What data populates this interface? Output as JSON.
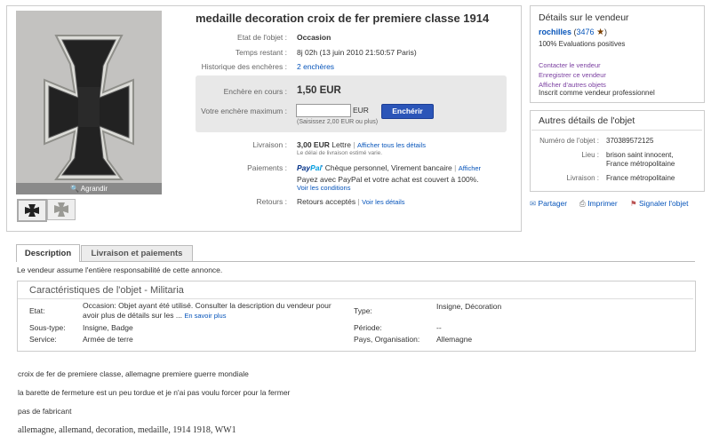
{
  "title": "medaille decoration croix de fer premiere classe 1914",
  "photo": {
    "enlarge_label": "Agrandir"
  },
  "details": {
    "etat_label": "Etat de l'objet :",
    "etat_value": "Occasion",
    "temps_label": "Temps restant :",
    "temps_value": "8j 02h (13 juin 2010 21:50:57 Paris)",
    "historique_label": "Historique des enchères :",
    "historique_value": "2 enchères"
  },
  "bid": {
    "current_label": "Enchère en cours :",
    "current_value": "1,50 EUR",
    "max_label": "Votre enchère maximum :",
    "input_value": "",
    "currency": "EUR",
    "button_label": "Enchérir",
    "min_bid_note": "(Saisissez 2,00 EUR ou plus)"
  },
  "shipping": {
    "label": "Livraison :",
    "price": "3,00 EUR",
    "method": "Lettre",
    "details_link": "Afficher tous les détails",
    "note": "Le délai de livraison estimé varie."
  },
  "payments": {
    "label": "Paiements :",
    "paypal_pay": "Pay",
    "paypal_pal": "Pal",
    "methods": "Chèque personnel, Virement bancaire",
    "show_link": "Afficher",
    "paypal_note": "Payez avec PayPal et votre achat est couvert à 100%.",
    "conditions_link": "Voir les conditions"
  },
  "returns": {
    "label": "Retours :",
    "value": "Retours acceptés",
    "details_link": "Voir les détails"
  },
  "seller": {
    "title": "Détails sur le vendeur",
    "name": "rochilles",
    "feedback_open": "(",
    "feedback": "3476",
    "feedback_close": ")",
    "positive": "100% Evaluations positives",
    "contact": "Contacter le vendeur",
    "save": "Enregistrer ce vendeur",
    "other_items": "Afficher d'autres objets",
    "registered": "Inscrit comme vendeur professionnel"
  },
  "other_details": {
    "title": "Autres détails de l'objet",
    "item_number_label": "Numéro de l'objet :",
    "item_number": "370389572125",
    "location_label": "Lieu :",
    "location_line1": "brison saint innocent,",
    "location_line2": "France métropolitaine",
    "shipping_label": "Livraison :",
    "shipping_value": "France métropolitaine"
  },
  "actions": {
    "share": "Partager",
    "print": "Imprimer",
    "report": "Signaler l'objet"
  },
  "tabs": {
    "description": "Description",
    "shipping": "Livraison et paiements"
  },
  "responsibility": "Le vendeur assume l'entière responsabilité de cette annonce.",
  "characteristics": {
    "title": "Caractéristiques de l'objet - Militaria",
    "etat_label": "Etat:",
    "etat_line1": "Occasion: Objet ayant été utilisé. Consulter la description du vendeur pour",
    "etat_line2": "avoir plus de détails sur les ...",
    "etat_more": "En savoir plus",
    "soustype_label": "Sous-type:",
    "soustype_value": "Insigne, Badge",
    "service_label": "Service:",
    "service_value": "Armée de terre",
    "type_label": "Type:",
    "type_value": "Insigne, Décoration",
    "periode_label": "Période:",
    "periode_value": "--",
    "pays_label": "Pays, Organisation:",
    "pays_value": "Allemagne"
  },
  "description": {
    "line1": "croix de fer de premiere classe, allemagne premiere guerre mondiale",
    "line2": "la barette de fermeture est un peu tordue et je n'ai pas voulu forcer pour la fermer",
    "line3": "pas de fabricant",
    "line4": "allemagne, allemand, decoration, medaille, 1914 1918, WW1"
  }
}
